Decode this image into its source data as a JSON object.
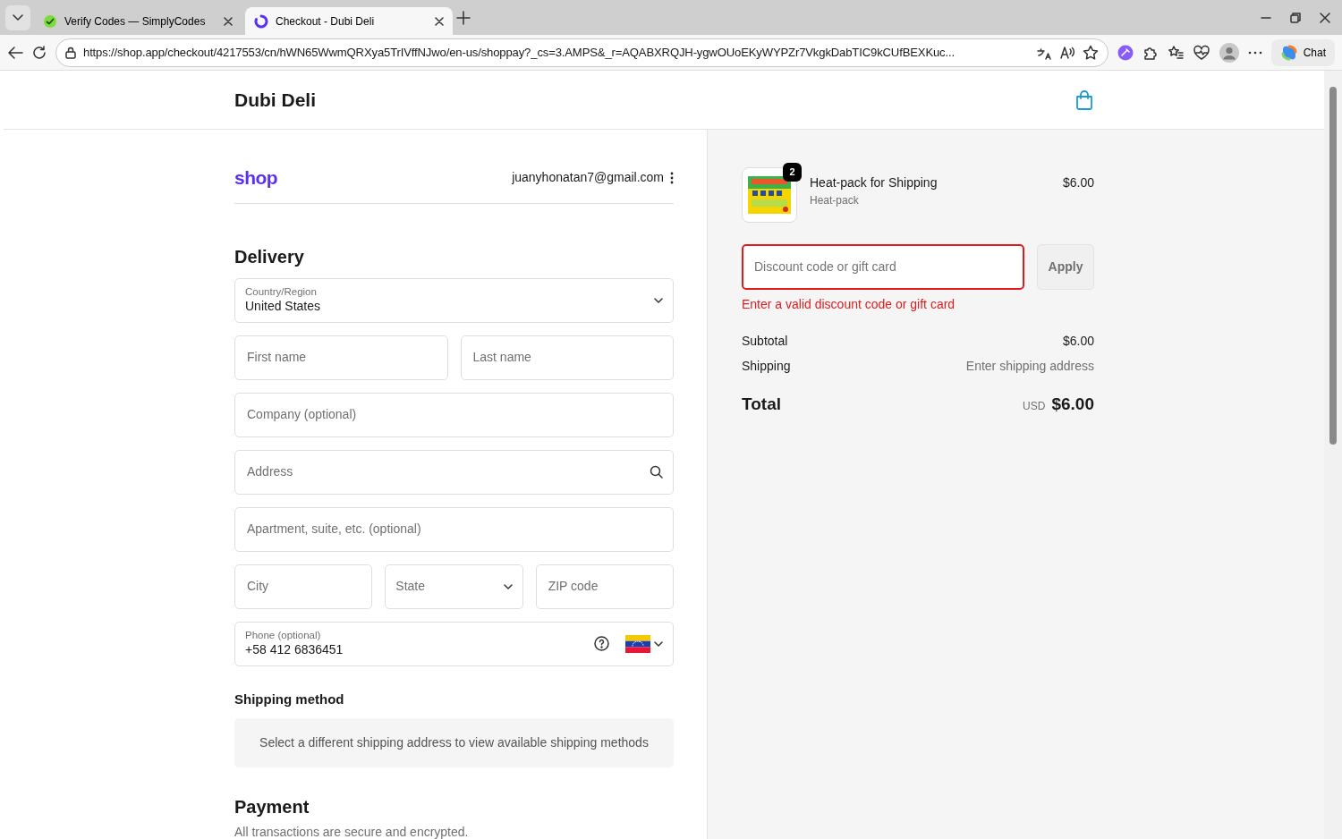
{
  "browser": {
    "tabs": [
      {
        "title": "Verify Codes — SimplyCodes",
        "selected": false
      },
      {
        "title": "Checkout - Dubi Deli",
        "selected": true
      }
    ],
    "url": "https://shop.app/checkout/4217553/cn/hWN65WwmQRXya5TrIVffNJwo/en-us/shoppay?_cs=3.AMPS&_r=AQABXRQJH-ygwOUoEKyWYPZr7VkgkDabTIC9kCUfBEXKuc...",
    "chat": "Chat"
  },
  "store": {
    "name": "Dubi Deli"
  },
  "account": {
    "logo": "shop",
    "email": "juanyhonatan7@gmail.com"
  },
  "delivery": {
    "heading": "Delivery",
    "rows": [
      [
        {
          "kind": "select",
          "label": "Country/Region",
          "value": "United States"
        }
      ],
      [
        {
          "kind": "text",
          "placeholder": "First name"
        },
        {
          "kind": "text",
          "placeholder": "Last name"
        }
      ],
      [
        {
          "kind": "text",
          "placeholder": "Company (optional)"
        }
      ],
      [
        {
          "kind": "search",
          "placeholder": "Address"
        }
      ],
      [
        {
          "kind": "text",
          "placeholder": "Apartment, suite, etc. (optional)"
        }
      ],
      [
        {
          "kind": "text",
          "placeholder": "City"
        },
        {
          "kind": "select",
          "placeholder": "State"
        },
        {
          "kind": "text",
          "placeholder": "ZIP code"
        }
      ],
      [
        {
          "kind": "phone",
          "label": "Phone (optional)",
          "value": "+58 412 6836451"
        }
      ]
    ]
  },
  "shipping_method": {
    "heading": "Shipping method",
    "notice": "Select a different shipping address to view available shipping methods"
  },
  "payment": {
    "heading": "Payment",
    "note": "All transactions are secure and encrypted."
  },
  "summary": {
    "item": {
      "name": "Heat-pack for Shipping",
      "variant": "Heat-pack",
      "price": "$6.00",
      "quantity": "2"
    },
    "discount": {
      "placeholder": "Discount code or gift card",
      "button": "Apply",
      "invalid": true,
      "error": "Enter a valid discount code or gift card"
    },
    "lines": [
      {
        "label": "Subtotal",
        "value": "$6.00",
        "muted": false
      },
      {
        "label": "Shipping",
        "value": "Enter shipping address",
        "muted": true
      }
    ],
    "total": {
      "label": "Total",
      "currency": "USD",
      "amount": "$6.00"
    }
  }
}
